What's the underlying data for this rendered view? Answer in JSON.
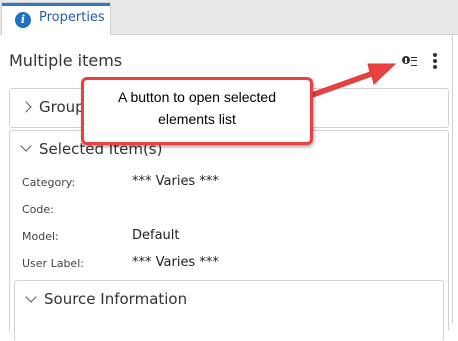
{
  "tab": {
    "label": "Properties",
    "icon": "info-icon"
  },
  "header": {
    "title": "Multiple items",
    "selected_list_button_icon": "selected-elements-list-icon",
    "more_menu_icon": "more-vertical-icon"
  },
  "sections": {
    "group": {
      "title": "Group"
    },
    "selected": {
      "title": "Selected Item(s)",
      "properties": [
        {
          "label": "Category:",
          "value": "*** Varies ***"
        },
        {
          "label": "Code:",
          "value": ""
        },
        {
          "label": "Model:",
          "value": "Default"
        },
        {
          "label": "User Label:",
          "value": "*** Varies ***"
        }
      ]
    },
    "source": {
      "title": "Source Information"
    }
  },
  "callout": {
    "line1": "A button to open selected",
    "line2": "elements list",
    "color": "#e8413f"
  },
  "colors": {
    "accent": "#2d79c7",
    "tab_text": "#1f5fa8",
    "border": "#d2d2d2"
  }
}
